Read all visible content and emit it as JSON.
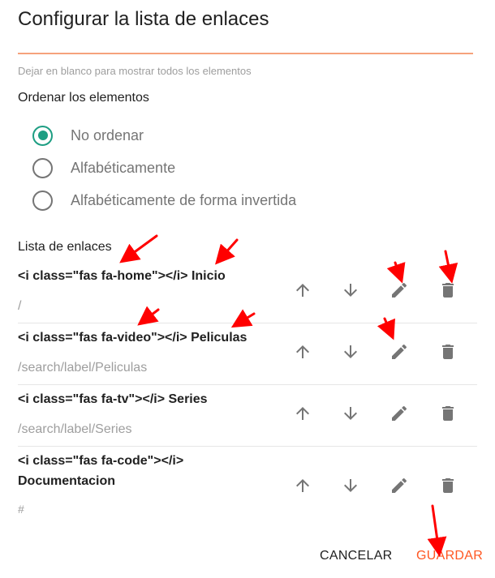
{
  "dialog": {
    "title": "Configurar la lista de enlaces",
    "filter_hint": "Dejar en blanco para mostrar todos los elementos",
    "sort_label": "Ordenar los elementos",
    "sort_options": [
      {
        "label": "No ordenar",
        "selected": true
      },
      {
        "label": "Alfabéticamente",
        "selected": false
      },
      {
        "label": "Alfabéticamente de forma invertida",
        "selected": false
      }
    ],
    "links_label": "Lista de enlaces",
    "links": [
      {
        "text": "<i class=\"fas fa-home\"></i> Inicio",
        "url": "/"
      },
      {
        "text": "<i class=\"fas fa-video\"></i> Peliculas",
        "url": "/search/label/Peliculas"
      },
      {
        "text": "<i class=\"fas fa-tv\"></i> Series",
        "url": "/search/label/Series"
      },
      {
        "text": "<i class=\"fas fa-code\"></i> Documentacion",
        "url": "#"
      }
    ],
    "item_actions": [
      "arrow-up-icon",
      "arrow-down-icon",
      "pencil-icon",
      "trash-icon"
    ],
    "cancel_label": "CANCELAR",
    "save_label": "GUARDAR"
  },
  "colors": {
    "accent": "#ff5722",
    "radio_checked": "#1e9e83",
    "icon": "#757575",
    "annotation_arrow": "#ff0000"
  }
}
